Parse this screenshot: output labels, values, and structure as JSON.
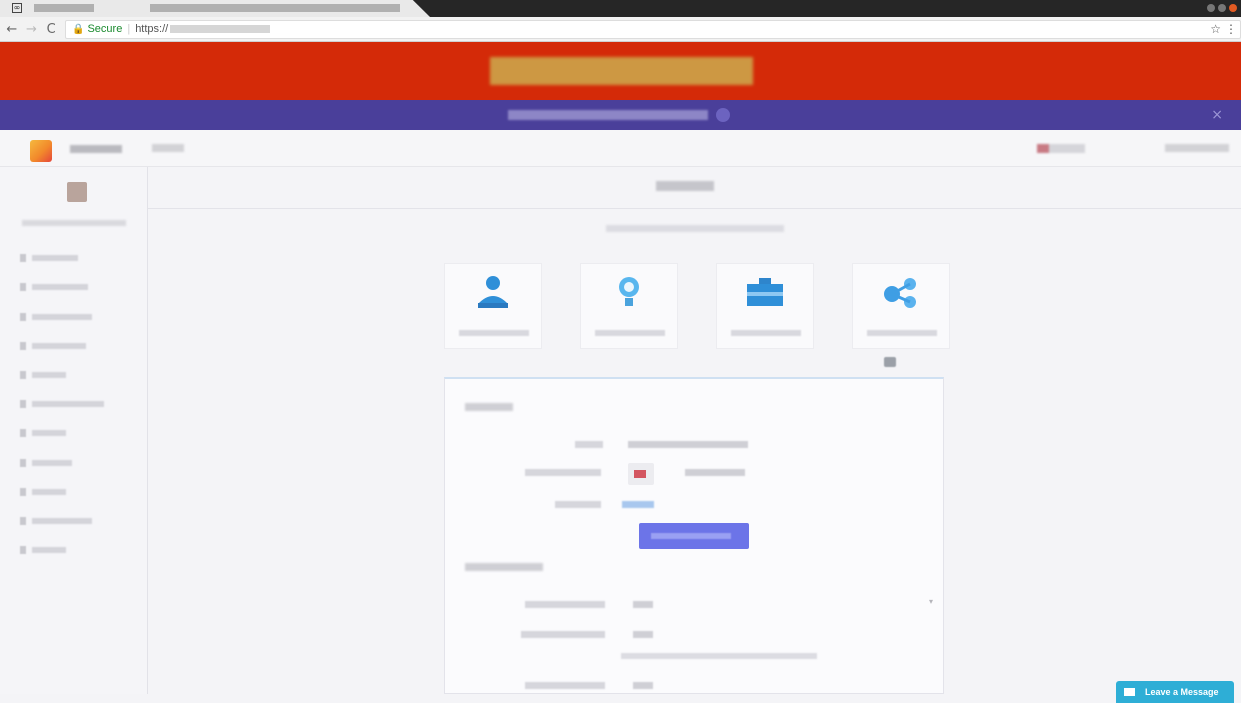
{
  "browser": {
    "secure_label": "Secure",
    "url_scheme": "https://"
  },
  "widget": {
    "leave_message": "Leave a Message"
  },
  "colors": {
    "top_banner": "#d42a08",
    "notice_bar": "#4a3f9a",
    "primary_button": "#6c74e8",
    "chat_button": "#2eaed6"
  },
  "cards": [
    {
      "icon": "user-icon"
    },
    {
      "icon": "lightbulb-icon"
    },
    {
      "icon": "briefcase-icon"
    },
    {
      "icon": "share-icon"
    }
  ]
}
